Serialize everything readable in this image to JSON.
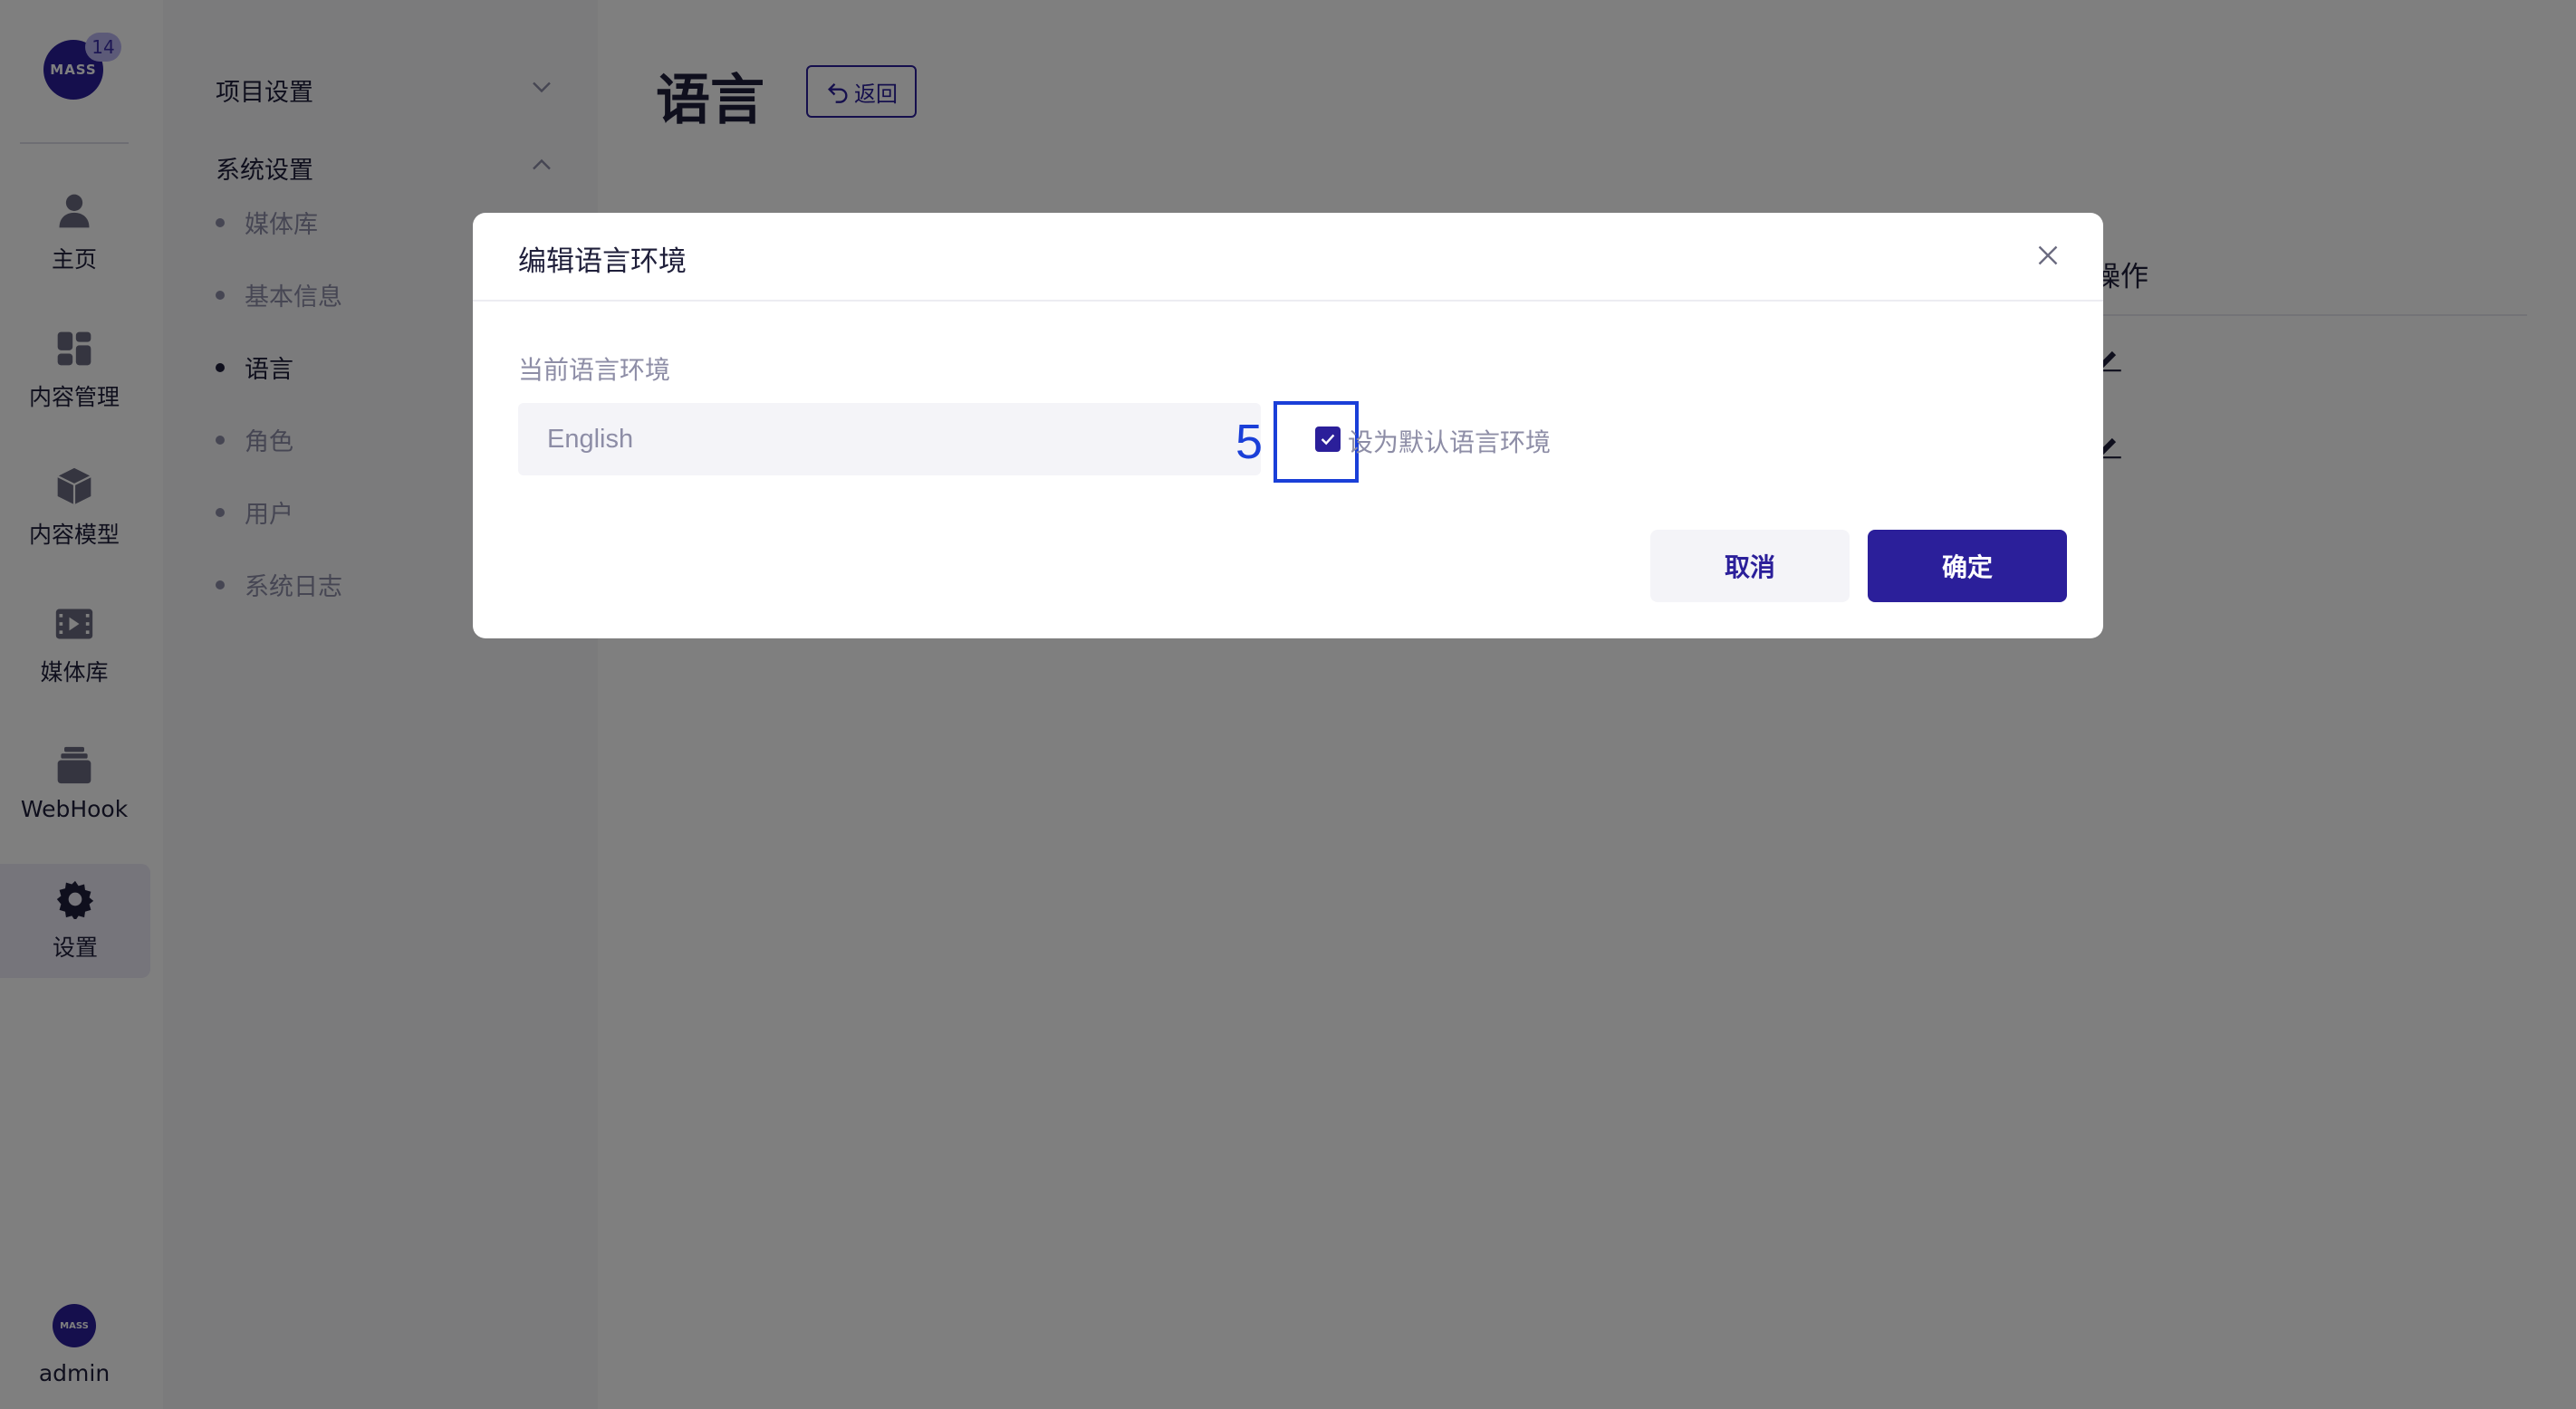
{
  "rail": {
    "logo_text": "MASS",
    "badge": "14",
    "items": [
      {
        "label": "主页"
      },
      {
        "label": "内容管理"
      },
      {
        "label": "内容模型"
      },
      {
        "label": "媒体库"
      },
      {
        "label": "WebHook"
      },
      {
        "label": "设置"
      }
    ],
    "user": {
      "avatar_text": "MASS",
      "name": "admin"
    }
  },
  "subnav": {
    "groups": [
      {
        "label": "项目设置",
        "icon": "chevron-down-icon"
      },
      {
        "label": "系统设置",
        "icon": "chevron-up-icon"
      }
    ],
    "items": [
      {
        "label": "媒体库"
      },
      {
        "label": "基本信息"
      },
      {
        "label": "语言"
      },
      {
        "label": "角色"
      },
      {
        "label": "用户"
      },
      {
        "label": "系统日志"
      }
    ],
    "current": "语言"
  },
  "main": {
    "title": "语言",
    "back_label": "返回",
    "column_header": "操作"
  },
  "modal": {
    "title": "编辑语言环境",
    "field_label": "当前语言环境",
    "input_value": "English",
    "checkbox_label": "设为默认语言环境",
    "checkbox_checked": true,
    "cancel_label": "取消",
    "ok_label": "确定"
  },
  "annotation": {
    "number": "5",
    "color": "#1a3fd8"
  },
  "colors": {
    "accent": "#2b1f9a",
    "muted": "#8d8da6"
  }
}
